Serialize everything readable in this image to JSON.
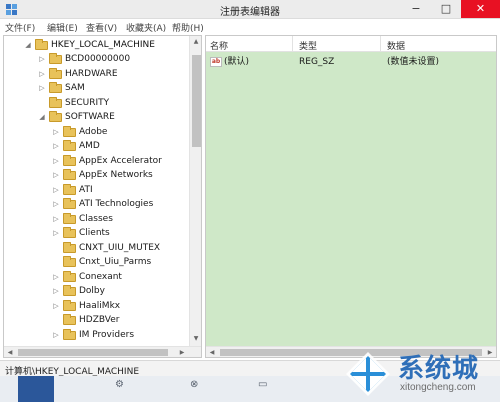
{
  "window": {
    "title": "注册表编辑器",
    "min_label": "−",
    "max_label": "□",
    "close_label": "✕"
  },
  "menu": [
    "文件(F)",
    "编辑(E)",
    "查看(V)",
    "收藏夹(A)",
    "帮助(H)"
  ],
  "tree": {
    "root": "HKEY_LOCAL_MACHINE",
    "root_children": [
      "BCD00000000",
      "HARDWARE",
      "SAM",
      "SECURITY",
      "SOFTWARE"
    ],
    "software_children": [
      "Adobe",
      "AMD",
      "AppEx Accelerator",
      "AppEx Networks",
      "ATI",
      "ATI Technologies",
      "Classes",
      "Clients",
      "CNXT_UIU_MUTEX",
      "Cnxt_Uiu_Parms",
      "Conexant",
      "Dolby",
      "HaaliMkx",
      "HDZBVer",
      "IM Providers"
    ]
  },
  "values": {
    "columns": {
      "name": "名称",
      "type": "类型",
      "data": "数据"
    },
    "rows": [
      {
        "icon": "string-value-icon",
        "badge": "ab",
        "name": "(默认)",
        "type": "REG_SZ",
        "data": "(数值未设置)"
      }
    ]
  },
  "status": {
    "path": "计算机\\HKEY_LOCAL_MACHINE"
  },
  "watermark": {
    "name": "系统城",
    "url": "xitongcheng.com"
  },
  "colors": {
    "values_pane_bg": "#cfe8c8",
    "close_button": "#e81123",
    "folder": "#e8c25a",
    "watermark_blue": "#2f6fb8"
  }
}
